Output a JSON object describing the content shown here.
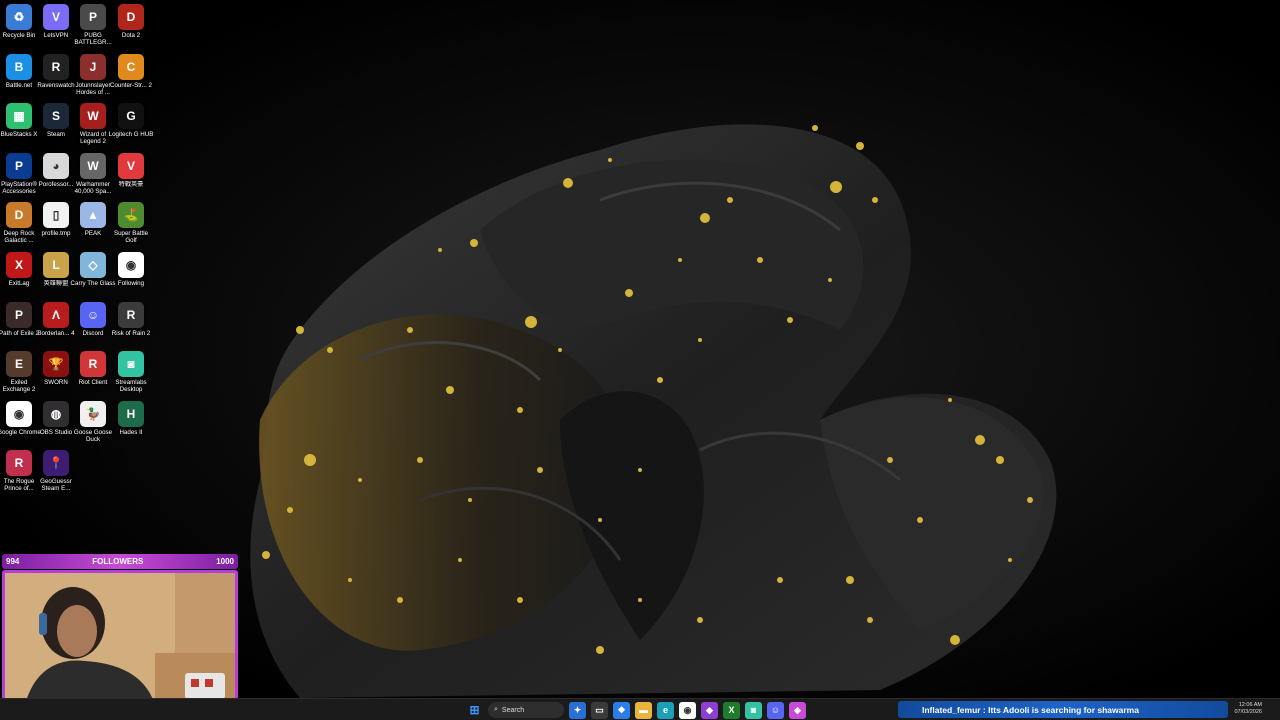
{
  "desktop_icons": [
    {
      "label": "Recycle Bin",
      "icon": "recycle-bin-icon",
      "color": "#3a7bd5",
      "glyph": "♻"
    },
    {
      "label": "LetsVPN",
      "icon": "vpn-icon",
      "color": "#7b6cf6",
      "glyph": "V"
    },
    {
      "label": "PUBG BATTLEGR...",
      "icon": "pubg-icon",
      "color": "#4a4a4a",
      "glyph": "P"
    },
    {
      "label": "Dota 2",
      "icon": "dota2-icon",
      "color": "#b1261b",
      "glyph": "D"
    },
    {
      "label": "Battle.net",
      "icon": "battlenet-icon",
      "color": "#1a8fe3",
      "glyph": "B"
    },
    {
      "label": "Ravenswatch",
      "icon": "ravenswatch-icon",
      "color": "#222",
      "glyph": "R"
    },
    {
      "label": "Jotunnslayer Hordes of ...",
      "icon": "jotunnslayer-icon",
      "color": "#8b2e2e",
      "glyph": "J"
    },
    {
      "label": "Counter-Str... 2",
      "icon": "counter-strike-icon",
      "color": "#e08a1e",
      "glyph": "C"
    },
    {
      "label": "BlueStacks X",
      "icon": "bluestacks-icon",
      "color": "#2fbf71",
      "glyph": "▦"
    },
    {
      "label": "Steam",
      "icon": "steam-icon",
      "color": "#1b2838",
      "glyph": "S"
    },
    {
      "label": "Wizard of Legend 2",
      "icon": "wizard-of-legend-icon",
      "color": "#a51f1f",
      "glyph": "W"
    },
    {
      "label": "Logitech G HUB",
      "icon": "logitech-icon",
      "color": "#111",
      "glyph": "G"
    },
    {
      "label": "PlayStation® Accessories",
      "icon": "playstation-icon",
      "color": "#0a3d91",
      "glyph": "P"
    },
    {
      "label": "Porofessor...",
      "icon": "porofessor-icon",
      "color": "#d8d8d8",
      "glyph": "◕"
    },
    {
      "label": "Warhammer 40,000 Spa...",
      "icon": "warhammer-icon",
      "color": "#666",
      "glyph": "W"
    },
    {
      "label": "特戰英豪",
      "icon": "valorant-icon",
      "color": "#e03a3e",
      "glyph": "V"
    },
    {
      "label": "Deep Rock Galactic ...",
      "icon": "deep-rock-icon",
      "color": "#c77a2a",
      "glyph": "D"
    },
    {
      "label": "profile.tmp",
      "icon": "file-icon",
      "color": "#f2f2f2",
      "glyph": "▯"
    },
    {
      "label": "PEAK",
      "icon": "peak-icon",
      "color": "#9bb7e8",
      "glyph": "▲"
    },
    {
      "label": "Super Battle Golf",
      "icon": "golf-icon",
      "color": "#4e8a2e",
      "glyph": "⛳"
    },
    {
      "label": "ExitLag",
      "icon": "exitlag-icon",
      "color": "#c01818",
      "glyph": "X"
    },
    {
      "label": "英雄聯盟",
      "icon": "league-icon",
      "color": "#c9a34a",
      "glyph": "L"
    },
    {
      "label": "Carry The Glass",
      "icon": "carry-glass-icon",
      "color": "#7fb6d9",
      "glyph": "◇"
    },
    {
      "label": "Following",
      "icon": "chrome-icon",
      "color": "#ffffff",
      "glyph": "◉"
    },
    {
      "label": "Path of Exile 2",
      "icon": "poe-icon",
      "color": "#3a2a2a",
      "glyph": "P"
    },
    {
      "label": "Borderlan... 4",
      "icon": "borderlands-icon",
      "color": "#b81c1c",
      "glyph": "Λ"
    },
    {
      "label": "Discord",
      "icon": "discord-icon",
      "color": "#5865f2",
      "glyph": "☺"
    },
    {
      "label": "Risk of Rain 2",
      "icon": "risk-of-rain-icon",
      "color": "#3b3b3b",
      "glyph": "R"
    },
    {
      "label": "Exiled Exchange 2",
      "icon": "exiled-exchange-icon",
      "color": "#553b2b",
      "glyph": "E"
    },
    {
      "label": "SWORN",
      "icon": "sworn-icon",
      "color": "#8d1010",
      "glyph": "🏆"
    },
    {
      "label": "Riot Client",
      "icon": "riot-icon",
      "color": "#d13639",
      "glyph": "R"
    },
    {
      "label": "Streamlabs Desktop",
      "icon": "streamlabs-icon",
      "color": "#31c3a2",
      "glyph": "◙"
    },
    {
      "label": "Google Chrome",
      "icon": "chrome-icon",
      "color": "#ffffff",
      "glyph": "◉"
    },
    {
      "label": "OBS Studio",
      "icon": "obs-icon",
      "color": "#302e31",
      "glyph": "◍"
    },
    {
      "label": "Goose Goose Duck",
      "icon": "goose-icon",
      "color": "#f0f0f0",
      "glyph": "🦆"
    },
    {
      "label": "Hades II",
      "icon": "hades-icon",
      "color": "#1d6b4a",
      "glyph": "H"
    },
    {
      "label": "The Rogue Prince of...",
      "icon": "rogue-prince-icon",
      "color": "#c02f4b",
      "glyph": "R"
    },
    {
      "label": "GeoGuessr Steam E...",
      "icon": "geoguessr-icon",
      "color": "#3c1d72",
      "glyph": "📍"
    }
  ],
  "overlay": {
    "followers_current": "994",
    "followers_label": "FOLLOWERS",
    "followers_goal": "1000",
    "goal_progress_fraction": 0.994
  },
  "taskbar": {
    "search_placeholder": "Search",
    "apps": [
      {
        "icon": "copilot-icon",
        "color": "#2a6fd6",
        "glyph": "✦"
      },
      {
        "icon": "task-view-icon",
        "color": "#3a3a3a",
        "glyph": "▭"
      },
      {
        "icon": "widgets-icon",
        "color": "#2b7de9",
        "glyph": "❖"
      },
      {
        "icon": "file-explorer-icon",
        "color": "#e8b43c",
        "glyph": "▬"
      },
      {
        "icon": "edge-icon",
        "color": "#1aa0b8",
        "glyph": "e"
      },
      {
        "icon": "chrome-icon",
        "color": "#ffffff",
        "glyph": "◉"
      },
      {
        "icon": "app-purple-icon",
        "color": "#8e3fd1",
        "glyph": "◆"
      },
      {
        "icon": "xbox-icon",
        "color": "#1e7d2c",
        "glyph": "X"
      },
      {
        "icon": "streamlabs-icon",
        "color": "#31c3a2",
        "glyph": "◙"
      },
      {
        "icon": "discord-icon",
        "color": "#5865f2",
        "glyph": "☺"
      },
      {
        "icon": "app-pink-icon",
        "color": "#c84bd6",
        "glyph": "◈"
      }
    ],
    "ticker_text": "Inflated_femur : Itts Adooli is searching for shawarma",
    "clock_time": "12:06 AM",
    "clock_date": "07/03/2026"
  }
}
